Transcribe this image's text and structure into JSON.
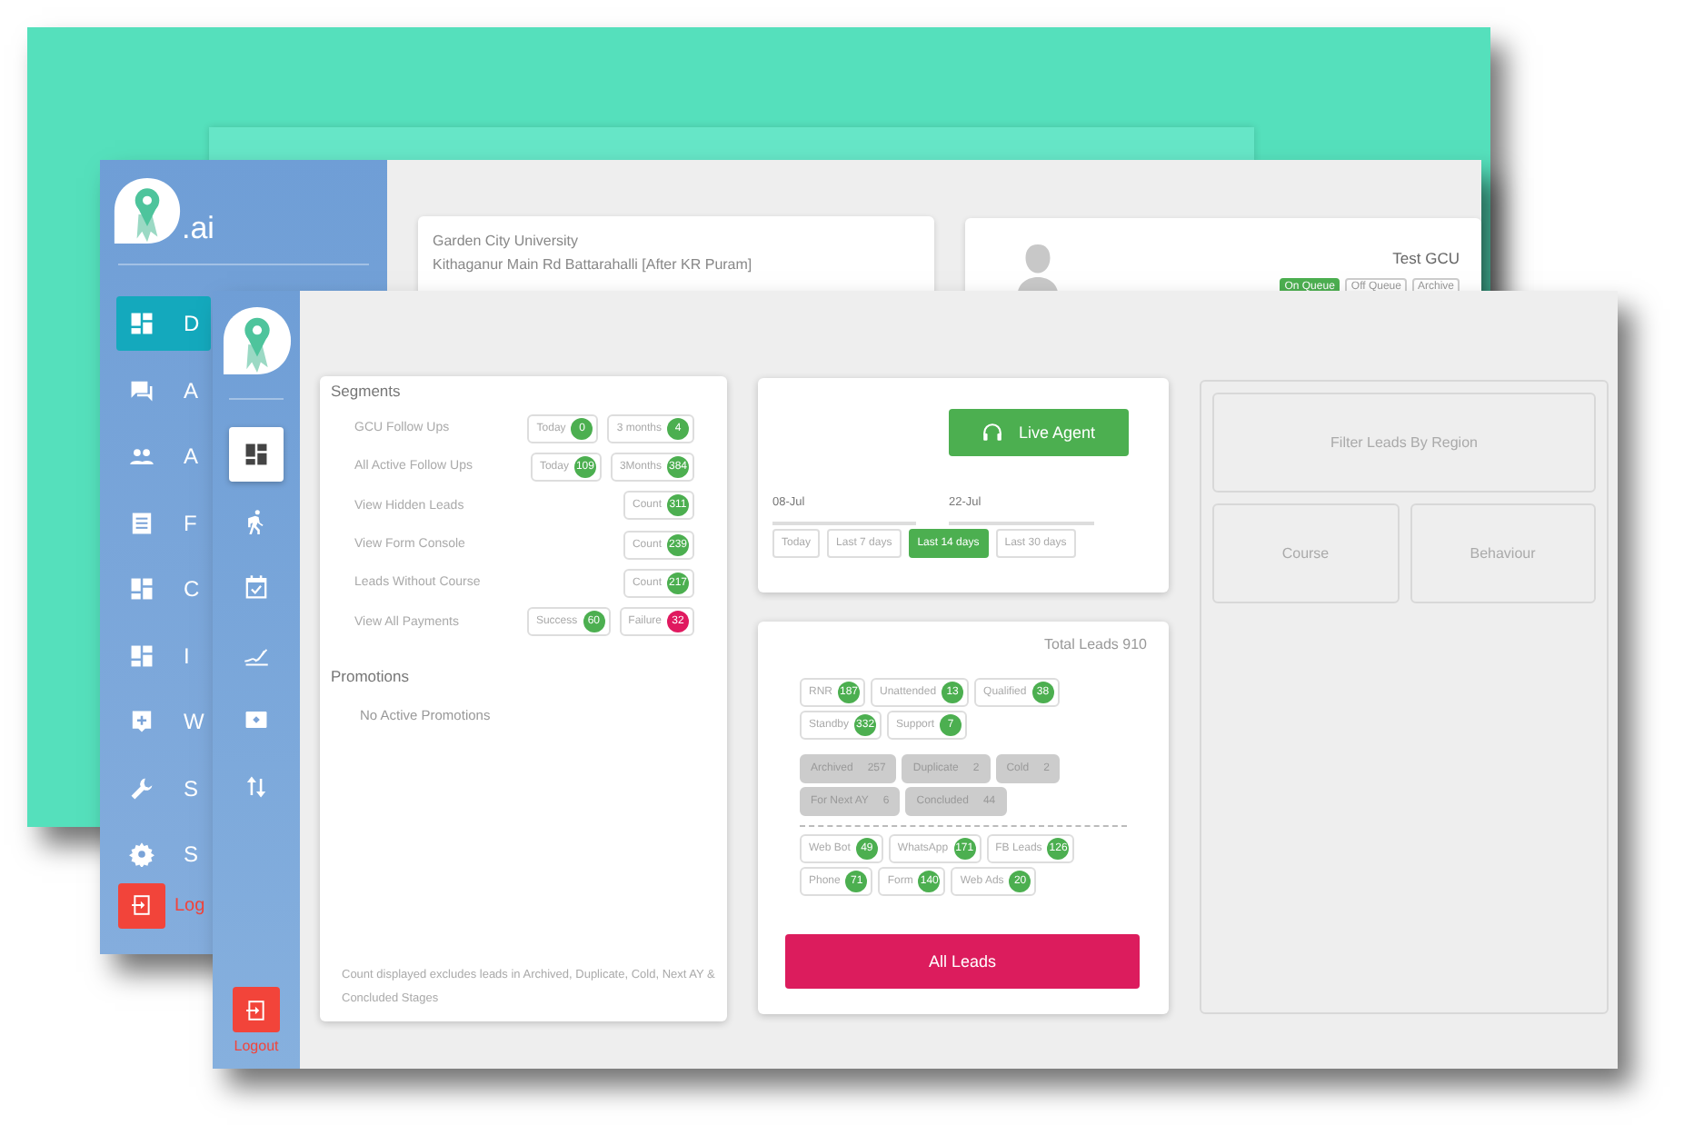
{
  "back_window": {
    "sidebar": {
      "brand": ".ai",
      "items": [
        {
          "label": "D",
          "selected": true
        },
        {
          "label": "A",
          "selected": false
        },
        {
          "label": "A",
          "selected": false
        },
        {
          "label": "F",
          "selected": false
        },
        {
          "label": "C",
          "selected": false
        },
        {
          "label": "I",
          "selected": false
        },
        {
          "label": "W",
          "selected": false
        },
        {
          "label": "S",
          "selected": false
        },
        {
          "label": "S",
          "selected": false
        }
      ],
      "logout": "Log"
    },
    "institution": {
      "name": "Garden City University",
      "address": "Kithaganur Main Rd  Battarahalli [After KR Puram]"
    },
    "profile": {
      "name": "Test GCU",
      "buttons": [
        {
          "label": "On Queue",
          "selected": true
        },
        {
          "label": "Off Queue",
          "selected": false
        },
        {
          "label": "Archive",
          "selected": false
        }
      ]
    }
  },
  "front_window": {
    "sidebar": {
      "items": [
        {
          "selected": true
        },
        {
          "selected": false
        },
        {
          "selected": false
        },
        {
          "selected": false
        },
        {
          "selected": false
        },
        {
          "selected": false
        }
      ],
      "logout": "Logout"
    },
    "segments": {
      "title": "Segments",
      "rows": [
        {
          "label": "GCU Follow Ups",
          "counters": [
            {
              "label": "Today",
              "count": "0",
              "color": "#4caf50"
            },
            {
              "label": "3 months",
              "count": "4",
              "color": "#4caf50"
            }
          ]
        },
        {
          "label": "All Active Follow Ups",
          "counters": [
            {
              "label": "Today",
              "count": "109",
              "color": "#4caf50"
            },
            {
              "label": "3Months",
              "count": "384",
              "color": "#4caf50"
            }
          ]
        },
        {
          "label": "View Hidden Leads",
          "counters": [
            {
              "label": "Count",
              "count": "311",
              "color": "#4caf50"
            }
          ]
        },
        {
          "label": "View Form Console",
          "counters": [
            {
              "label": "Count",
              "count": "239",
              "color": "#4caf50"
            }
          ]
        },
        {
          "label": "Leads Without Course",
          "counters": [
            {
              "label": "Count",
              "count": "217",
              "color": "#4caf50"
            }
          ]
        },
        {
          "label": "View All Payments",
          "counters": [
            {
              "label": "Success",
              "count": "60",
              "color": "#4caf50"
            },
            {
              "label": "Failure",
              "count": "32",
              "color": "#e0195f"
            }
          ]
        }
      ],
      "promotions_title": "Promotions",
      "promotions_empty": "No Active Promotions",
      "note": "Count displayed excludes leads in Archived, Duplicate, Cold, Next AY & Concluded Stages"
    },
    "agent": {
      "button": "Live Agent",
      "dates": [
        "08-Jul",
        "22-Jul"
      ],
      "ranges": [
        {
          "label": "Today",
          "selected": false
        },
        {
          "label": "Last 7 days",
          "selected": false
        },
        {
          "label": "Last 14 days",
          "selected": true
        },
        {
          "label": "Last 30 days",
          "selected": false
        }
      ]
    },
    "leads": {
      "total": "Total Leads 910",
      "groups": [
        {
          "kind": "active",
          "chips": [
            {
              "label": "RNR",
              "count": "187"
            },
            {
              "label": "Unattended",
              "count": "13"
            },
            {
              "label": "Qualified",
              "count": "38"
            },
            {
              "label": "Standby",
              "count": "332"
            },
            {
              "label": "Support",
              "count": "7"
            }
          ]
        },
        {
          "kind": "closed",
          "chips": [
            {
              "label": "Archived",
              "count": "257"
            },
            {
              "label": "Duplicate",
              "count": "2"
            },
            {
              "label": "Cold",
              "count": "2"
            },
            {
              "label": "For Next AY",
              "count": "6"
            },
            {
              "label": "Concluded",
              "count": "44"
            }
          ]
        },
        {
          "kind": "source",
          "chips": [
            {
              "label": "Web Bot",
              "count": "49"
            },
            {
              "label": "WhatsApp",
              "count": "171"
            },
            {
              "label": "FB Leads",
              "count": "126"
            },
            {
              "label": "Phone",
              "count": "71"
            },
            {
              "label": "Form",
              "count": "140"
            },
            {
              "label": "Web Ads",
              "count": "20"
            }
          ]
        }
      ],
      "all_leads": "All Leads"
    },
    "filters": {
      "region": "Filter Leads By Region",
      "options": [
        "Course",
        "Behaviour"
      ]
    }
  }
}
